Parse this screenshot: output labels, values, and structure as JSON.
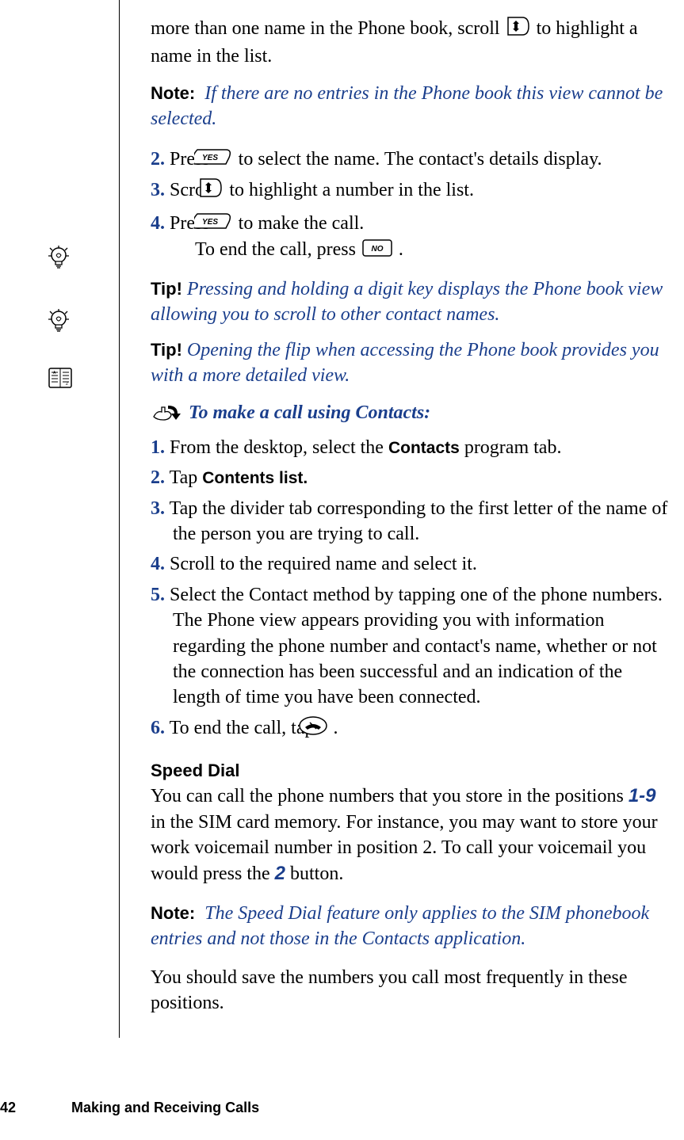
{
  "intro": {
    "line1_a": "more than one name in the Phone book, scroll ",
    "line1_b": " to highlight a name in the list."
  },
  "note1": {
    "label": "Note:",
    "text": "If there are no entries in the Phone book this view cannot be selected."
  },
  "stepsA": {
    "s2_a": "Press ",
    "s2_b": " to select the name. The contact's details display.",
    "s3_a": "Scroll ",
    "s3_b": " to highlight a number in the list.",
    "s4_a": "Press ",
    "s4_b": " to make the call.",
    "s4_c_a": "To end the call, press ",
    "s4_c_b": "."
  },
  "tip1": {
    "label": "Tip!",
    "text": "Pressing and holding a digit key displays the Phone book view allowing you to scroll to other contact names."
  },
  "tip2": {
    "label": "Tip!",
    "text": "Opening the flip when accessing the Phone book provides you with a more detailed view."
  },
  "proc": {
    "title": "To make a call using Contacts:",
    "s1_a": "From the desktop, select the ",
    "s1_b": "Contacts",
    "s1_c": " program tab.",
    "s2_a": "Tap ",
    "s2_b": "Contents list.",
    "s3": "Tap the divider tab corresponding to the first letter of the name of the person you are trying to call.",
    "s4": "Scroll to the required name and select it.",
    "s5": "Select the Contact method by tapping one of the phone numbers. The Phone view appears providing you with information regarding the phone number and contact's name, whether or not the connection has been successful and an indication of the length of time you have been connected.",
    "s6_a": "To end the call, tap ",
    "s6_b": " ."
  },
  "speed": {
    "title": "Speed Dial",
    "p1_a": "You can call the phone numbers that you store in the positions ",
    "p1_b": "1-9",
    "p1_c": " in the SIM card memory. For instance, you may want to store your work voicemail number in position 2. To call your voicemail you would press the ",
    "p1_d": "2",
    "p1_e": " button."
  },
  "note2": {
    "label": "Note:",
    "text": "The Speed Dial feature only applies to the SIM phonebook entries and not those in the Contacts application."
  },
  "closing": {
    "text": "You should save the numbers you call most frequently in these positions."
  },
  "footer": {
    "page": "42",
    "title": "Making and Receiving Calls"
  },
  "nums": {
    "n1": "1.",
    "n2": "2.",
    "n3": "3.",
    "n4": "4.",
    "n5": "5.",
    "n6": "6."
  }
}
